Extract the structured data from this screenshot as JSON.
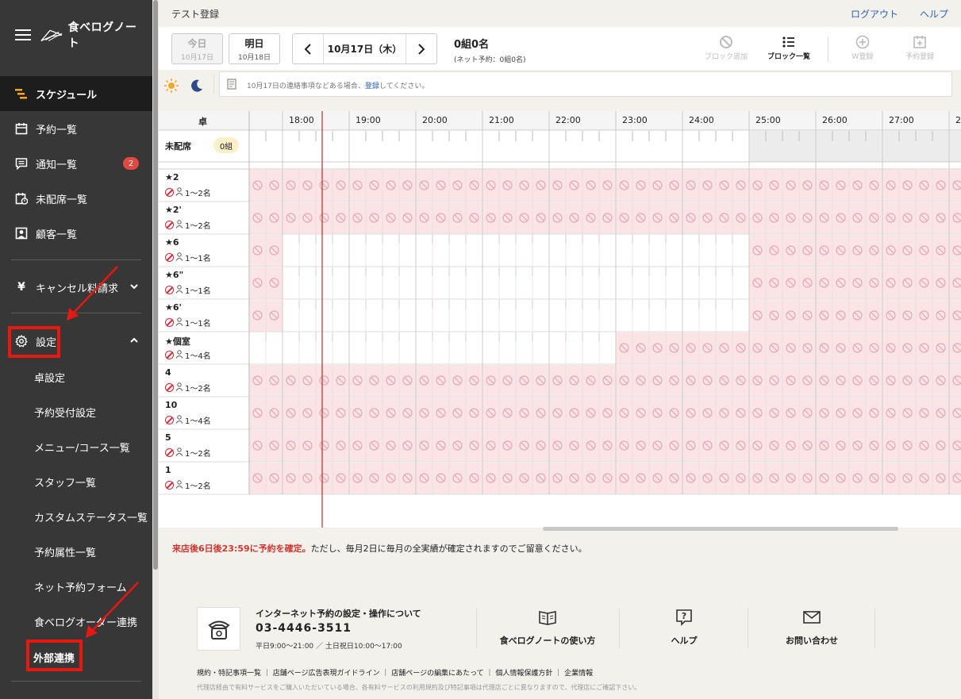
{
  "sidebar": {
    "logo_text": "食べログノート",
    "items": [
      {
        "label": "スケジュール",
        "icon": "schedule-icon"
      },
      {
        "label": "予約一覧",
        "icon": "calendar-icon"
      },
      {
        "label": "通知一覧",
        "icon": "chat-icon",
        "badge": "2"
      },
      {
        "label": "未配席一覧",
        "icon": "calendar-alert-icon"
      },
      {
        "label": "顧客一覧",
        "icon": "customer-icon"
      }
    ],
    "cancel_label": "キャンセル料請求",
    "cancel_icon_text": "¥",
    "settings_label": "設定",
    "settings_subitems": [
      "卓設定",
      "予約受付設定",
      "メニュー/コース一覧",
      "スタッフ一覧",
      "カスタムステータス一覧",
      "予約属性一覧",
      "ネット予約フォーム",
      "食べログオーダー連携",
      "外部連携"
    ]
  },
  "header": {
    "title": "テスト登録",
    "logout": "ログアウト",
    "help": "ヘルプ"
  },
  "toolbar": {
    "today_label": "今日",
    "today_date": "10月17日",
    "tomorrow_label": "明日",
    "tomorrow_date": "10月18日",
    "current_date": "10月17日（木）",
    "prev_arrow": "‹",
    "next_arrow": "›",
    "count": "0組0名",
    "net_count": "(ネット予約：0組0名)",
    "block_add": "ブロック追加",
    "block_list": "ブロック一覧",
    "walkin": "W登録",
    "reserve": "予約登録"
  },
  "notebar": {
    "text_before": "10月17日の連絡事項などある場合、",
    "link": "登録",
    "text_after": "してください。"
  },
  "grid": {
    "table_header": "卓",
    "hours": [
      "18:00",
      "19:00",
      "20:00",
      "21:00",
      "22:00",
      "23:00",
      "24:00",
      "25:00",
      "26:00",
      "27:00",
      "2"
    ],
    "unassigned_label": "未配席",
    "unassigned_count": "0組",
    "rows": [
      {
        "name": "★2",
        "capacity": "1～2名"
      },
      {
        "name": "★2'",
        "capacity": "1～2名"
      },
      {
        "name": "★6",
        "capacity": "1～1名"
      },
      {
        "name": "★6\"",
        "capacity": "1～1名"
      },
      {
        "name": "★6'",
        "capacity": "1～1名"
      },
      {
        "name": "★個室",
        "capacity": "1～4名"
      },
      {
        "name": "4",
        "capacity": "1～2名"
      },
      {
        "name": "10",
        "capacity": "1～4名"
      },
      {
        "name": "5",
        "capacity": "1～2名"
      },
      {
        "name": "1",
        "capacity": "1～2名"
      }
    ],
    "blocked_color": "#fbe4e6",
    "now_line_color": "#c62828"
  },
  "confirm": {
    "highlight": "来店後6日後23:59に予約を確定。",
    "rest": "ただし、毎月2日に毎月の全実績が確定されますのでご留意ください。"
  },
  "footer": {
    "title": "インターネット予約の設定・操作について",
    "tel": "03-4446-3511",
    "hours": "平日9:00～21:00 ／ 土日祝日10:00～17:00",
    "guide": "食べログノートの使い方",
    "help": "ヘルプ",
    "contact": "お問い合わせ",
    "links": "規約・特記事項一覧 ｜ 店舗ページ広告表現ガイドライン ｜ 店舗ページの編集にあたって ｜ 個人情報保護方針 ｜ 企業情報",
    "note": "代理店経由で有料サービスをご購入いただいている場合、各有料サービスの利用規約及び特記事項は代理店ごとに異なりますので、代理店にご確認下さい。"
  }
}
